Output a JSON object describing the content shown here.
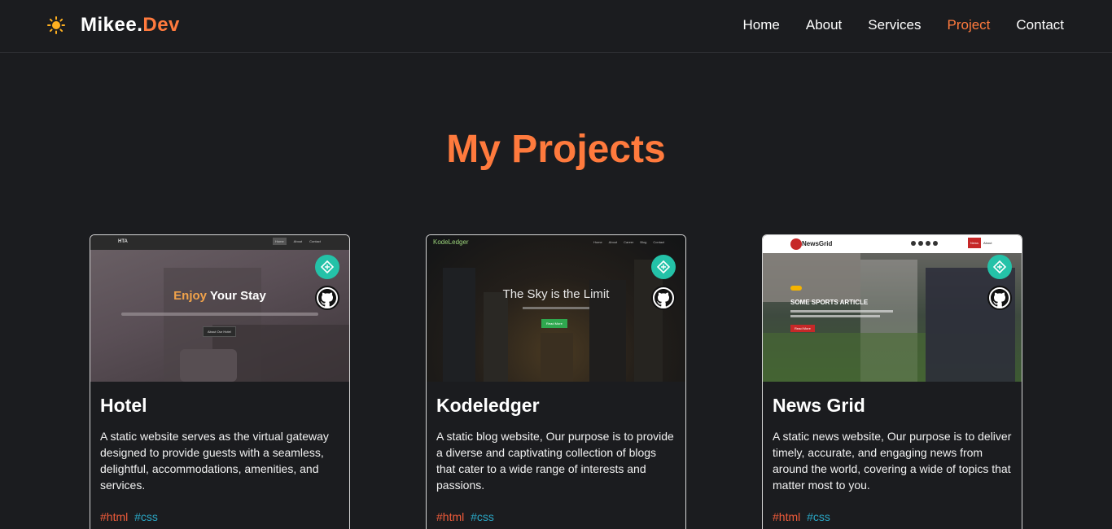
{
  "nav": {
    "brand_first": "Mikee.",
    "brand_second": "Dev",
    "links": [
      "Home",
      "About",
      "Services",
      "Project",
      "Contact"
    ],
    "active": "Project"
  },
  "section": {
    "title": "My Projects"
  },
  "colors": {
    "accent": "#ff7a3d",
    "live_icon": "#24c2a8",
    "tag_html": "#ef5b3a",
    "tag_css": "#2aa6c4"
  },
  "projects": [
    {
      "title": "Hotel",
      "description": "A static website serves as the virtual gateway designed to provide guests with a seamless, delightful, accommodations, amenities, and services.",
      "tags": [
        "#html",
        "#css"
      ],
      "preview": {
        "brand": "HTA",
        "heading_a": "Enjoy",
        "heading_b": "Your Stay",
        "cta": "About Our Hotel",
        "nav": [
          "Home",
          "About",
          "Contact"
        ]
      },
      "icons": [
        "live-demo-icon",
        "github-icon"
      ]
    },
    {
      "title": "Kodeledger",
      "description": "A static blog website, Our purpose is to provide a diverse and captivating collection of blogs that cater to a wide range of interests and passions.",
      "tags": [
        "#html",
        "#css"
      ],
      "preview": {
        "brand": "KodeLedger",
        "heading": "The Sky is the Limit",
        "cta": "Read More",
        "nav": [
          "Home",
          "About",
          "Career",
          "Blog",
          "Contact"
        ]
      },
      "icons": [
        "live-demo-icon",
        "github-icon"
      ]
    },
    {
      "title": "News Grid",
      "description": "A static news website, Our purpose is to deliver timely, accurate, and engaging news from around the world, covering a wide of topics that matter most to you.",
      "tags": [
        "#html",
        "#css"
      ],
      "preview": {
        "brand": "NewsGrid",
        "heading": "SOME SPORTS ARTICLE",
        "cta": "Read More",
        "nav": [
          "News",
          "About"
        ]
      },
      "icons": [
        "live-demo-icon",
        "github-icon"
      ]
    }
  ]
}
